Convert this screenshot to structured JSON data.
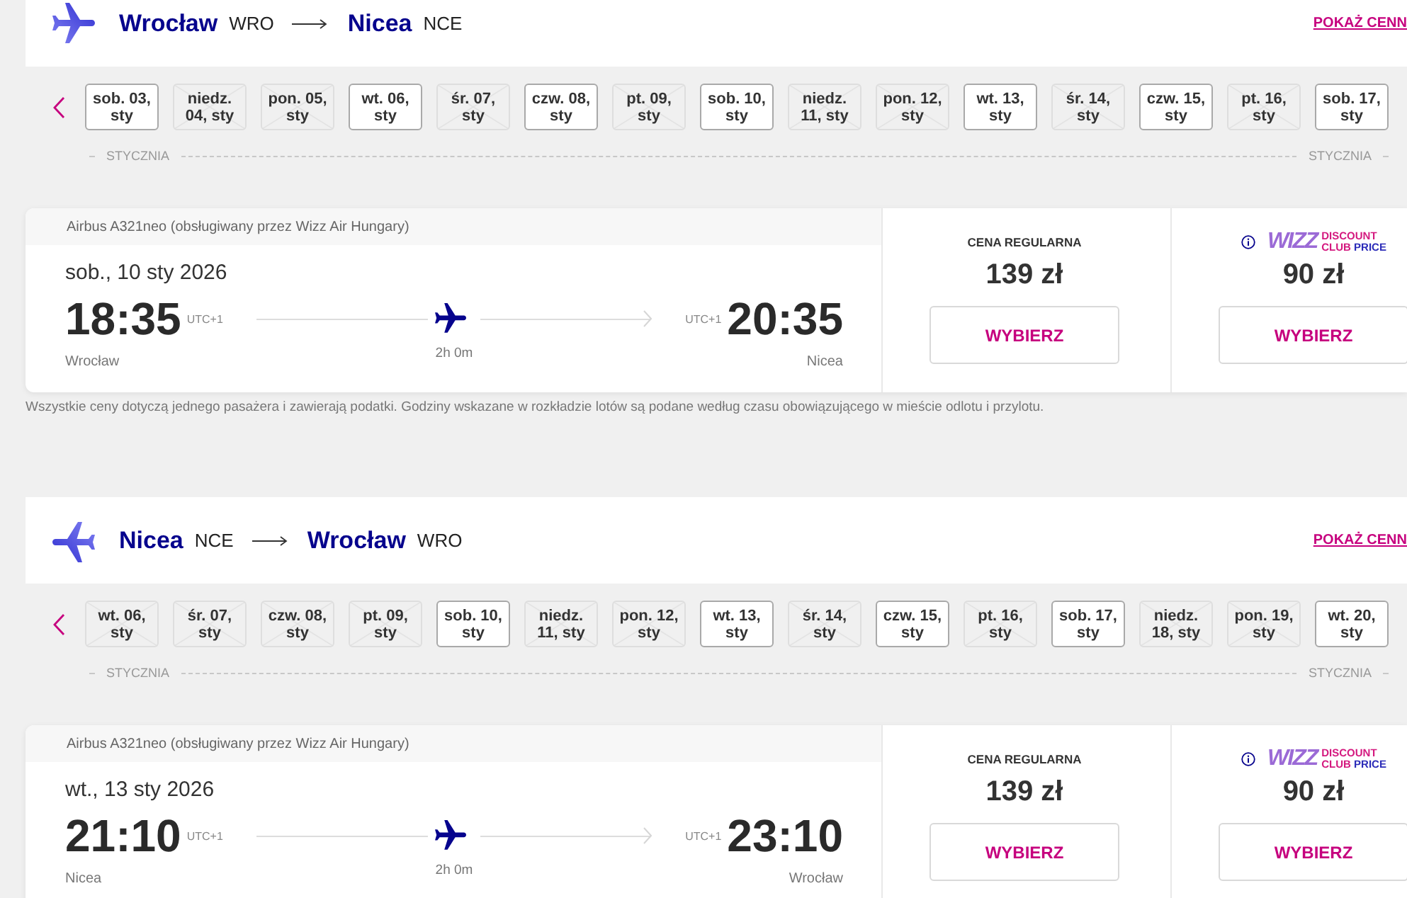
{
  "flights": [
    {
      "return_flight": false,
      "origin": {
        "city": "Wrocław",
        "code": "WRO"
      },
      "destination": {
        "city": "Nicea",
        "code": "NCE"
      },
      "price_link": "POKAŻ CENN",
      "dates": [
        {
          "label": "sob. 03, sty",
          "available": true
        },
        {
          "label": "niedz. 04, sty",
          "available": false
        },
        {
          "label": "pon. 05, sty",
          "available": false
        },
        {
          "label": "wt. 06, sty",
          "available": true
        },
        {
          "label": "śr. 07, sty",
          "available": false
        },
        {
          "label": "czw. 08, sty",
          "available": true
        },
        {
          "label": "pt. 09, sty",
          "available": false
        },
        {
          "label": "sob. 10, sty",
          "available": true
        },
        {
          "label": "niedz. 11, sty",
          "available": false
        },
        {
          "label": "pon. 12, sty",
          "available": false
        },
        {
          "label": "wt. 13, sty",
          "available": true
        },
        {
          "label": "śr. 14, sty",
          "available": false
        },
        {
          "label": "czw. 15, sty",
          "available": true
        },
        {
          "label": "pt. 16, sty",
          "available": false
        },
        {
          "label": "sob. 17, sty",
          "available": true
        }
      ],
      "month_labels": [
        "STYCZNIA",
        "STYCZNIA"
      ],
      "card": {
        "aircraft": "Airbus A321neo (obsługiwany przez Wizz Air Hungary)",
        "date": "sob., 10 sty 2026",
        "departure": {
          "time": "18:35",
          "utc": "UTC+1",
          "city": "Wrocław"
        },
        "duration": "2h 0m",
        "arrival": {
          "time": "20:35",
          "utc": "UTC+1",
          "city": "Nicea"
        },
        "fares": [
          {
            "kind": "regular",
            "title": "CENA REGULARNA",
            "price": "139 zł",
            "button": "WYBIERZ"
          },
          {
            "kind": "club",
            "badge": {
              "brand": "WIZZ",
              "line_1": "DISCOUNT",
              "line_2": "CLUB",
              "line_2_accent": "PRICE"
            },
            "price": "90 zł",
            "button": "WYBIERZ"
          }
        ]
      },
      "note": "Wszystkie ceny dotyczą jednego pasażera i zawierają podatki. Godziny wskazane w rozkładzie lotów są podane według czasu obowiązującego w mieście odlotu i przylotu."
    },
    {
      "return_flight": true,
      "origin": {
        "city": "Nicea",
        "code": "NCE"
      },
      "destination": {
        "city": "Wrocław",
        "code": "WRO"
      },
      "price_link": "POKAŻ CENN",
      "dates": [
        {
          "label": "wt. 06, sty",
          "available": false
        },
        {
          "label": "śr. 07, sty",
          "available": false
        },
        {
          "label": "czw. 08, sty",
          "available": false
        },
        {
          "label": "pt. 09, sty",
          "available": false
        },
        {
          "label": "sob. 10, sty",
          "available": true
        },
        {
          "label": "niedz. 11, sty",
          "available": false
        },
        {
          "label": "pon. 12, sty",
          "available": false
        },
        {
          "label": "wt. 13, sty",
          "available": true
        },
        {
          "label": "śr. 14, sty",
          "available": false
        },
        {
          "label": "czw. 15, sty",
          "available": true
        },
        {
          "label": "pt. 16, sty",
          "available": false
        },
        {
          "label": "sob. 17, sty",
          "available": true
        },
        {
          "label": "niedz. 18, sty",
          "available": false
        },
        {
          "label": "pon. 19, sty",
          "available": false
        },
        {
          "label": "wt. 20, sty",
          "available": true
        }
      ],
      "month_labels": [
        "STYCZNIA",
        "STYCZNIA"
      ],
      "card": {
        "aircraft": "Airbus A321neo (obsługiwany przez Wizz Air Hungary)",
        "date": "wt., 13 sty 2026",
        "departure": {
          "time": "21:10",
          "utc": "UTC+1",
          "city": "Nicea"
        },
        "duration": "2h 0m",
        "arrival": {
          "time": "23:10",
          "utc": "UTC+1",
          "city": "Wrocław"
        },
        "fares": [
          {
            "kind": "regular",
            "title": "CENA REGULARNA",
            "price": "139 zł",
            "button": "WYBIERZ"
          },
          {
            "kind": "club",
            "badge": {
              "brand": "WIZZ",
              "line_1": "DISCOUNT",
              "line_2": "CLUB",
              "line_2_accent": "PRICE"
            },
            "price": "90 zł",
            "button": "WYBIERZ"
          }
        ]
      }
    }
  ]
}
